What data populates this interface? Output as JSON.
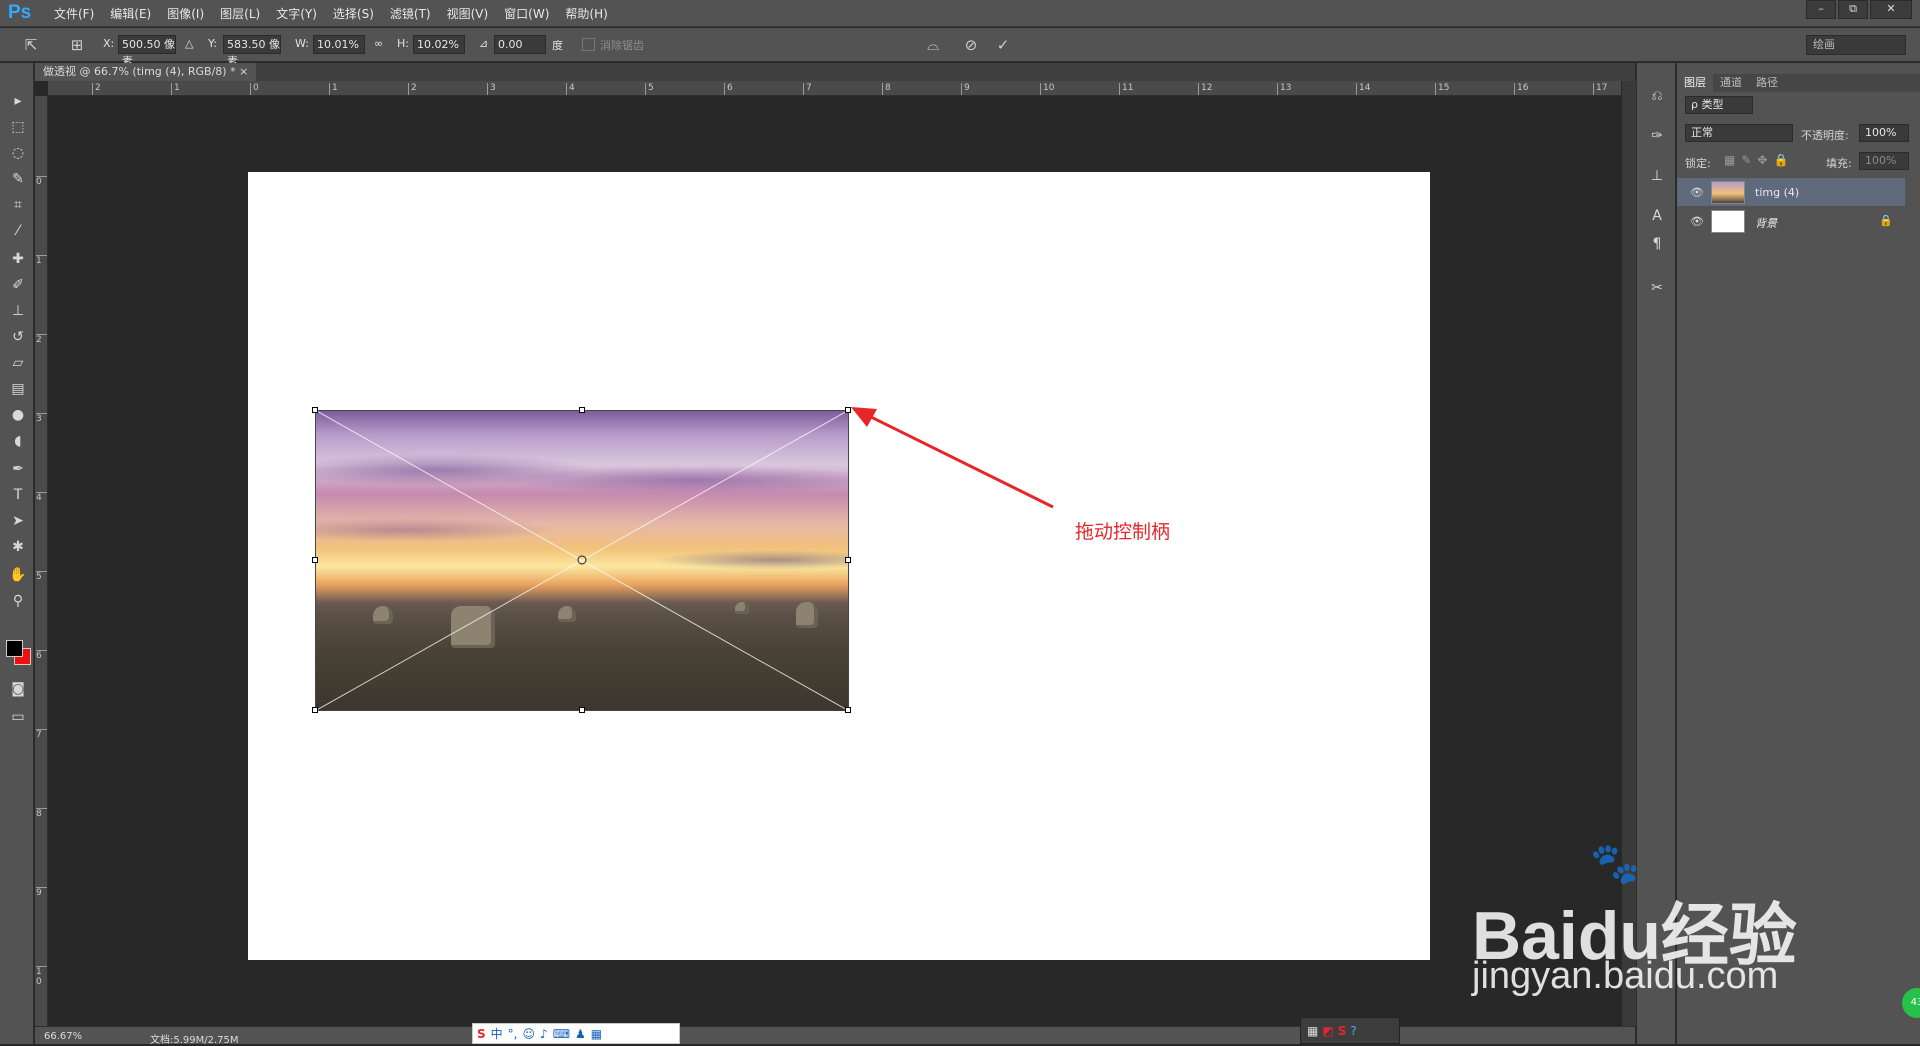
{
  "app": {
    "logo": "Ps"
  },
  "menu": [
    "文件(F)",
    "编辑(E)",
    "图像(I)",
    "图层(L)",
    "文字(Y)",
    "选择(S)",
    "滤镜(T)",
    "视图(V)",
    "窗口(W)",
    "帮助(H)"
  ],
  "window_controls": [
    "–",
    "⧉",
    "✕"
  ],
  "options": {
    "x_label": "X:",
    "x_value": "500.50 像素",
    "y_label": "Y:",
    "y_value": "583.50 像素",
    "w_label": "W:",
    "w_value": "10.01%",
    "h_label": "H:",
    "h_value": "10.02%",
    "angle_value": "0.00",
    "angle_unit": "度",
    "antialias_label": "消除锯齿",
    "workspace": "绘画"
  },
  "document_tab": "做透视 @ 66.7% (timg (4), RGB/8) * ×",
  "ruler_h": [
    "2",
    "1",
    "0",
    "1",
    "2",
    "3",
    "4",
    "5",
    "6",
    "7",
    "8",
    "9",
    "10",
    "11",
    "12",
    "13",
    "14",
    "15",
    "16",
    "17"
  ],
  "ruler_v": [
    "0",
    "1",
    "2",
    "3",
    "4",
    "5",
    "6",
    "7",
    "8",
    "9",
    "1 0"
  ],
  "annotation": "拖动控制柄",
  "panel": {
    "tabs": [
      "图层",
      "通道",
      "路径"
    ],
    "filter": "ρ 类型",
    "blend_mode": "正常",
    "opacity_label": "不透明度:",
    "opacity_value": "100%",
    "lock_label": "锁定:",
    "fill_label": "填充:",
    "fill_value": "100%",
    "layers": [
      {
        "name": "timg (4)",
        "selected": true
      },
      {
        "name": "背景",
        "locked": true
      }
    ]
  },
  "status": {
    "zoom": "66.67%",
    "doc": "文档:5.99M/2.75M"
  },
  "ime": {
    "label": "中"
  },
  "watermark": {
    "brand": "Baidu经验",
    "url": "jingyan.baidu.com"
  },
  "badge": "43",
  "colors": {
    "accent": "#31a8ff",
    "annotation": "#e8262a",
    "foreground": "#000000",
    "background": "#ee1111"
  }
}
